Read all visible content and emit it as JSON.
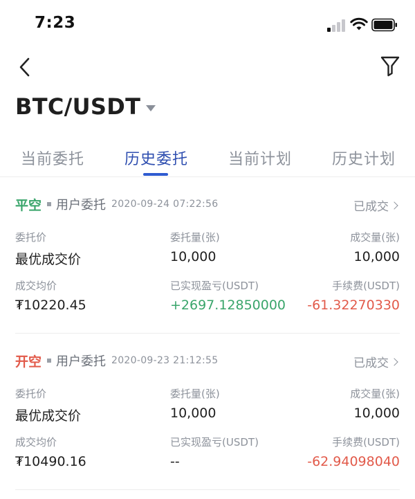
{
  "status_bar": {
    "time": "7:23"
  },
  "header": {
    "pair": "BTC/USDT"
  },
  "tabs": [
    {
      "label": "当前委托",
      "active": false
    },
    {
      "label": "历史委托",
      "active": true
    },
    {
      "label": "当前计划",
      "active": false
    },
    {
      "label": "历史计划",
      "active": false
    }
  ],
  "orders": [
    {
      "side": "平空",
      "side_color": "#3aa56b",
      "type": "用户委托",
      "time": "2020-09-24 07:22:56",
      "status": "已成交",
      "labels": {
        "price": "委托价",
        "amount": "委托量(张)",
        "filled": "成交量(张)",
        "avg": "成交均价",
        "pnl": "已实现盈亏(USDT)",
        "fee": "手续费(USDT)"
      },
      "values": {
        "price": "最优成交价",
        "amount": "10,000",
        "filled": "10,000",
        "avg": "₮10220.45",
        "pnl": "+2697.12850000",
        "fee": "-61.32270330"
      }
    },
    {
      "side": "开空",
      "side_color": "#e25a4a",
      "type": "用户委托",
      "time": "2020-09-23 21:12:55",
      "status": "已成交",
      "labels": {
        "price": "委托价",
        "amount": "委托量(张)",
        "filled": "成交量(张)",
        "avg": "成交均价",
        "pnl": "已实现盈亏(USDT)",
        "fee": "手续费(USDT)"
      },
      "values": {
        "price": "最优成交价",
        "amount": "10,000",
        "filled": "10,000",
        "avg": "₮10490.16",
        "pnl": "--",
        "fee": "-62.94098040"
      }
    }
  ],
  "colors": {
    "accent": "#2f5bd0",
    "profit": "#3aa56b",
    "loss": "#e25a4a",
    "muted": "#8d929b"
  },
  "icons": [
    "back-icon",
    "filter-icon",
    "signal-icon",
    "wifi-icon",
    "battery-icon",
    "chevron-right-icon",
    "dropdown-caret-icon"
  ]
}
